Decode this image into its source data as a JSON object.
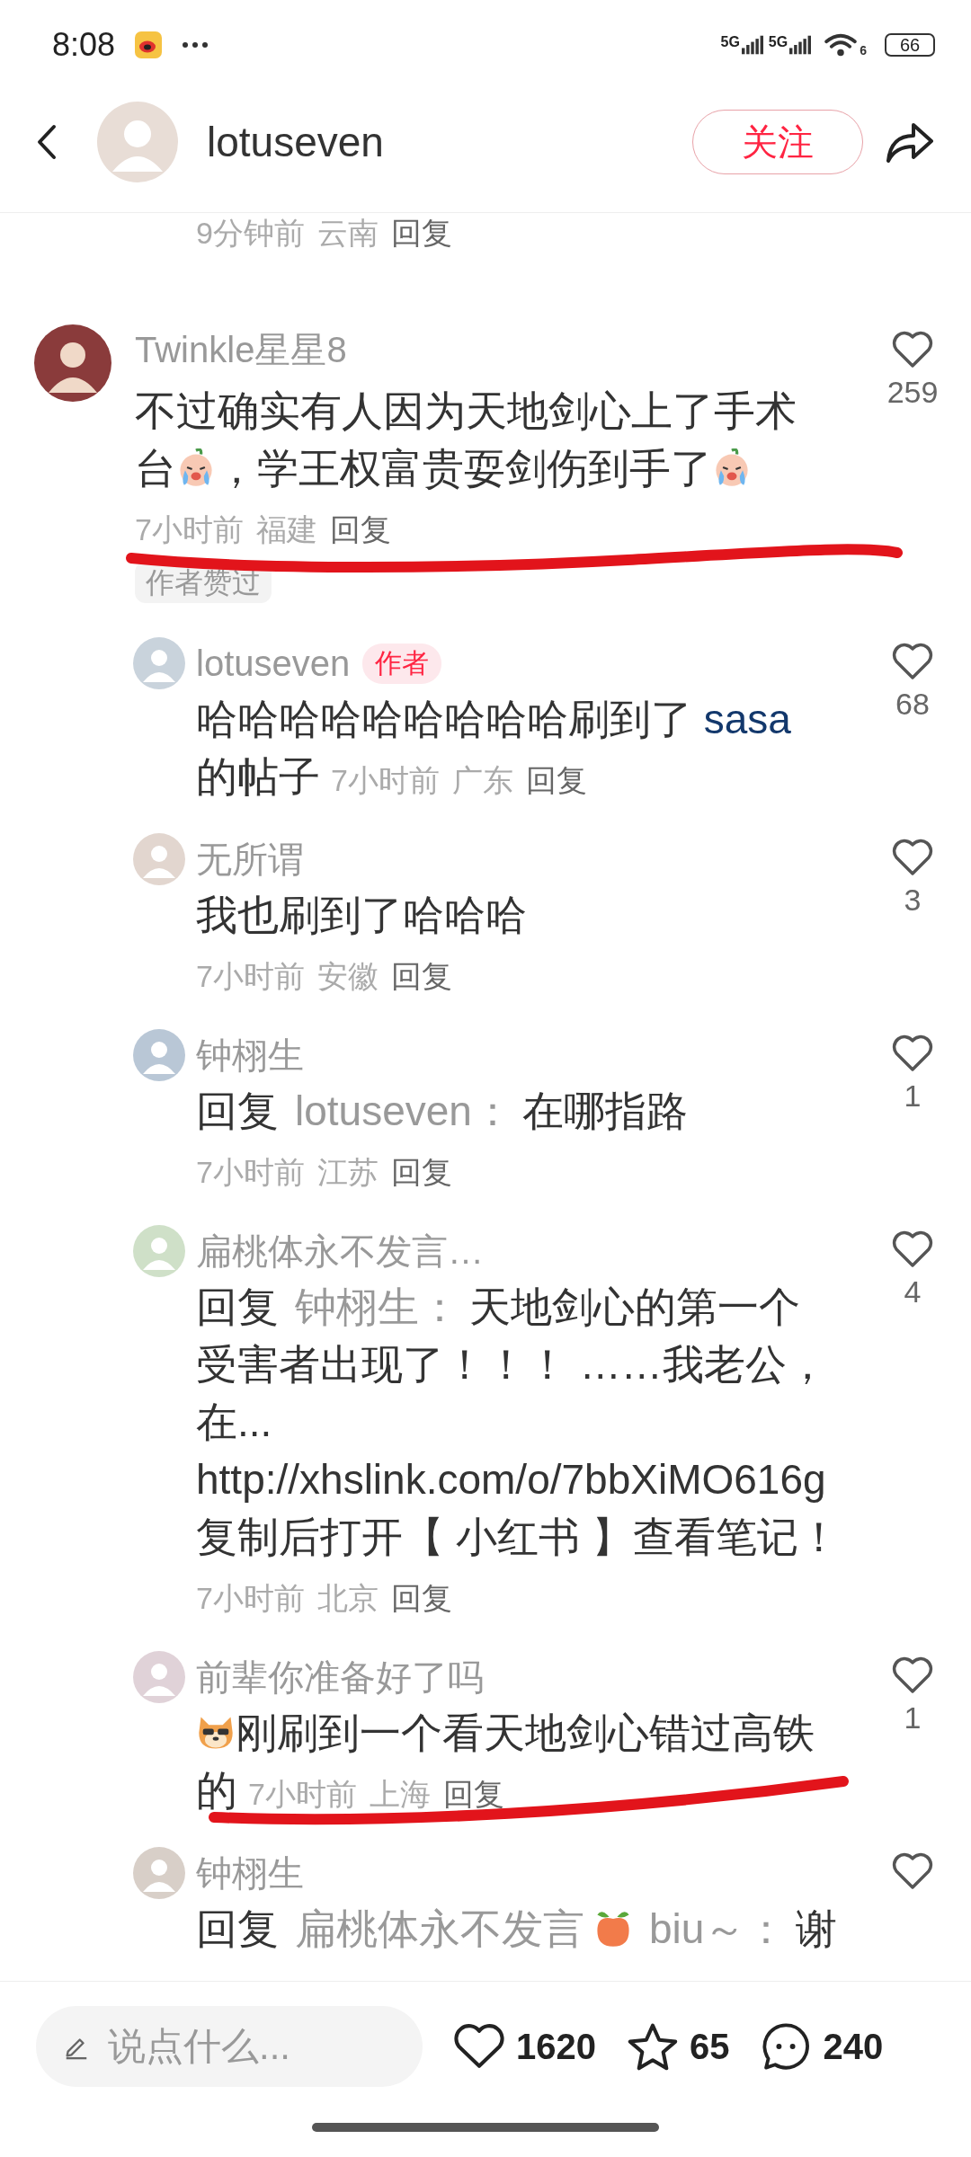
{
  "status_bar": {
    "time": "8:08",
    "signals": [
      "5G",
      "5G"
    ],
    "wifi_label": "6",
    "battery": "66"
  },
  "header": {
    "username": "lotuseven",
    "follow_button": "关注"
  },
  "previous_meta": {
    "time": "9分钟前",
    "location": "云南",
    "reply": "回复"
  },
  "comment": {
    "author": "Twinkle星星8",
    "likes": "259",
    "time": "7小时前",
    "location": "福建",
    "reply": "回复",
    "author_liked": "作者赞过",
    "underlined": true,
    "lines": [
      [
        {
          "kind": "text",
          "text": "不过确实有人因为天地剑心上了手术"
        }
      ],
      [
        {
          "kind": "text",
          "text": "台"
        },
        {
          "kind": "cry"
        },
        {
          "kind": "text",
          "text": "，学王权富贵耍剑伤到手了"
        },
        {
          "kind": "cry"
        }
      ]
    ],
    "replies": [
      {
        "author": "lotuseven",
        "author_badge": "作者",
        "likes": "68",
        "time": "7小时前",
        "location": "广东",
        "reply": "回复",
        "meta_inline": true,
        "underlined": false,
        "lines": [
          [
            {
              "kind": "text",
              "text": "哈哈哈哈哈哈哈哈哈刷到了 "
            },
            {
              "kind": "link",
              "text": "sasa"
            }
          ],
          [
            {
              "kind": "text",
              "text": "的帖子"
            }
          ]
        ]
      },
      {
        "author": "无所谓",
        "likes": "3",
        "time": "7小时前",
        "location": "安徽",
        "reply": "回复",
        "meta_inline": false,
        "underlined": false,
        "lines": [
          [
            {
              "kind": "text",
              "text": "我也刷到了哈哈哈"
            }
          ]
        ]
      },
      {
        "author": "钟栩生",
        "likes": "1",
        "time": "7小时前",
        "location": "江苏",
        "reply": "回复",
        "meta_inline": false,
        "underlined": false,
        "lines": [
          [
            {
              "kind": "text",
              "text": "回复"
            },
            {
              "kind": "mention",
              "text": "lotuseven："
            },
            {
              "kind": "text",
              "text": "在哪指路"
            }
          ]
        ]
      },
      {
        "author": "扁桃体永不发言…",
        "likes": "4",
        "time": "7小时前",
        "location": "北京",
        "reply": "回复",
        "meta_inline": false,
        "underlined": false,
        "lines": [
          [
            {
              "kind": "text",
              "text": "回复"
            },
            {
              "kind": "mention",
              "text": "钟栩生："
            },
            {
              "kind": "text",
              "text": "天地剑心的第一个"
            }
          ],
          [
            {
              "kind": "text",
              "text": "受害者出现了！！！ ……我老公，"
            }
          ],
          [
            {
              "kind": "text",
              "text": "在..."
            }
          ],
          [
            {
              "kind": "text",
              "text": "http://xhslink.com/o/7bbXiMO616g"
            }
          ],
          [
            {
              "kind": "text",
              "text": "复制后打开【 小红书 】查看笔记！"
            }
          ]
        ]
      },
      {
        "author": "前辈你准备好了吗",
        "likes": "1",
        "time": "7小时前",
        "location": "上海",
        "reply": "回复",
        "meta_inline": true,
        "underlined": true,
        "lines": [
          [
            {
              "kind": "dog"
            },
            {
              "kind": "text",
              "text": "刚刷到一个看天地剑心错过高铁"
            }
          ],
          [
            {
              "kind": "text",
              "text": "的"
            }
          ]
        ]
      },
      {
        "author": "钟栩生",
        "underlined": false,
        "lines": [
          [
            {
              "kind": "text",
              "text": "回复"
            },
            {
              "kind": "mention",
              "text": "扁桃体永不发言"
            },
            {
              "kind": "peach"
            },
            {
              "kind": "mention",
              "text": "biu～："
            },
            {
              "kind": "text",
              "text": "谢"
            }
          ]
        ]
      }
    ]
  },
  "bottom_bar": {
    "placeholder": "说点什么...",
    "likes": "1620",
    "favorites": "65",
    "comments": "240"
  }
}
